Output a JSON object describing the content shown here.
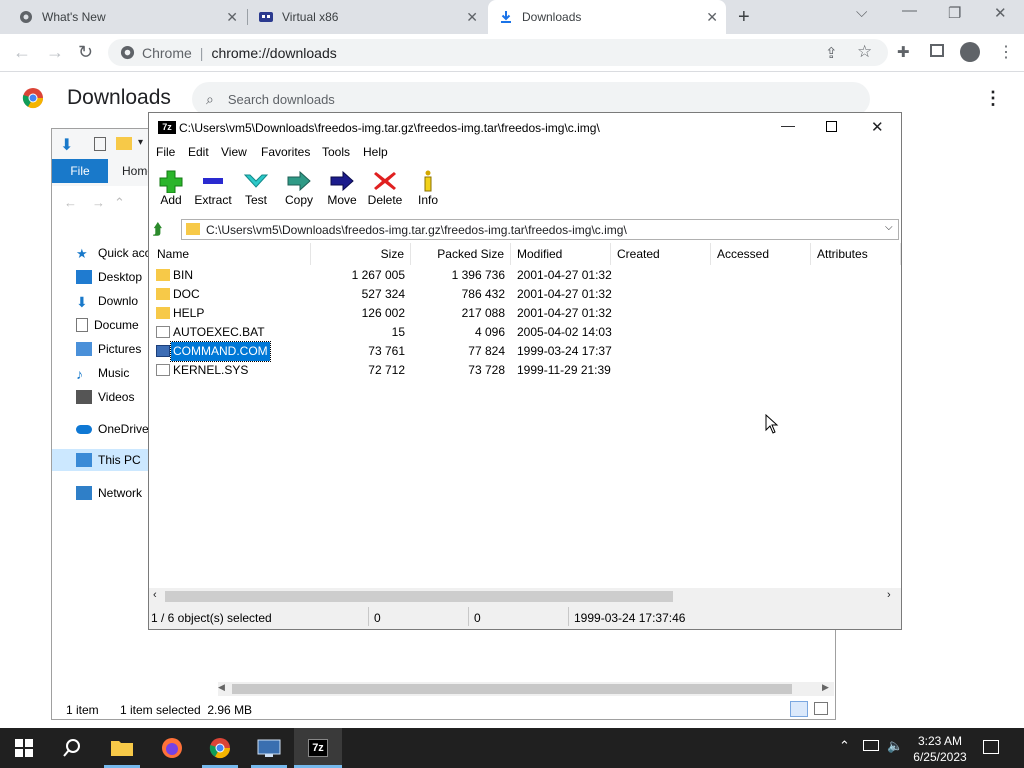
{
  "chrome": {
    "tabs": [
      {
        "label": "What's New",
        "icon": "chrome-gear-icon"
      },
      {
        "label": "Virtual x86",
        "icon": "virtual-x86-icon"
      },
      {
        "label": "Downloads",
        "icon": "download-icon"
      }
    ],
    "address_site": "Chrome",
    "address_url": "chrome://downloads"
  },
  "downloads_page": {
    "title": "Downloads",
    "search_placeholder": "Search downloads"
  },
  "explorer": {
    "ribbon_file": "File",
    "ribbon_home": "Home",
    "nav": [
      "Quick acce",
      "Desktop",
      "Downlo",
      "Docume",
      "Pictures",
      "Music",
      "Videos",
      "OneDrive",
      "This PC",
      "Network"
    ],
    "status_items": "1 item",
    "status_selected": "1 item selected  2.96 MB"
  },
  "sevenzip": {
    "title": "C:\\Users\\vm5\\Downloads\\freedos-img.tar.gz\\freedos-img.tar\\freedos-img\\c.img\\",
    "title_logo": "7z",
    "menu": [
      "File",
      "Edit",
      "View",
      "Favorites",
      "Tools",
      "Help"
    ],
    "toolbar": [
      {
        "label": "Add",
        "icon": "add-icon"
      },
      {
        "label": "Extract",
        "icon": "extract-icon"
      },
      {
        "label": "Test",
        "icon": "test-icon"
      },
      {
        "label": "Copy",
        "icon": "copy-icon"
      },
      {
        "label": "Move",
        "icon": "move-icon"
      },
      {
        "label": "Delete",
        "icon": "delete-icon"
      },
      {
        "label": "Info",
        "icon": "info-icon"
      }
    ],
    "address": "C:\\Users\\vm5\\Downloads\\freedos-img.tar.gz\\freedos-img.tar\\freedos-img\\c.img\\",
    "columns": [
      "Name",
      "Size",
      "Packed Size",
      "Modified",
      "Created",
      "Accessed",
      "Attributes"
    ],
    "rows": [
      {
        "name": "BIN",
        "size": "1 267 005",
        "packed": "1 396 736",
        "modified": "2001-04-27 01:32",
        "type": "folder"
      },
      {
        "name": "DOC",
        "size": "527 324",
        "packed": "786 432",
        "modified": "2001-04-27 01:32",
        "type": "folder"
      },
      {
        "name": "HELP",
        "size": "126 002",
        "packed": "217 088",
        "modified": "2001-04-27 01:32",
        "type": "folder"
      },
      {
        "name": "AUTOEXEC.BAT",
        "size": "15",
        "packed": "4 096",
        "modified": "2005-04-02 14:03",
        "type": "file"
      },
      {
        "name": "COMMAND.COM",
        "size": "73 761",
        "packed": "77 824",
        "modified": "1999-03-24 17:37",
        "type": "exe"
      },
      {
        "name": "KERNEL.SYS",
        "size": "72 712",
        "packed": "73 728",
        "modified": "1999-11-29 21:39",
        "type": "file"
      }
    ],
    "selected_row": 4,
    "status": {
      "selection": "1 / 6 object(s) selected",
      "size": "0",
      "packed": "0",
      "modified": "1999-03-24 17:37:46"
    }
  },
  "taskbar": {
    "time": "3:23 AM",
    "date": "6/25/2023"
  },
  "colors": {
    "accent": "#1a73e8",
    "selection": "#0078d7",
    "taskbar": "#202020"
  }
}
